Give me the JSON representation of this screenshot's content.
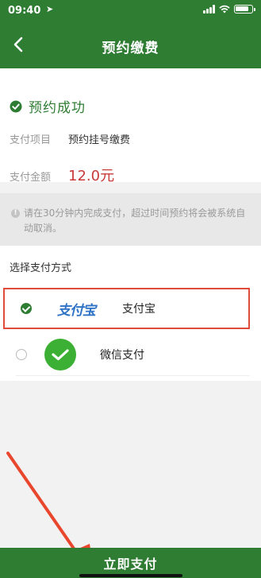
{
  "status_bar": {
    "time": "09:40"
  },
  "nav": {
    "title": "预约缴费"
  },
  "result": {
    "status": "预约成功"
  },
  "details": [
    {
      "label": "支付项目",
      "value": "预约挂号缴费"
    },
    {
      "label": "支付金额",
      "value": "12.0元"
    }
  ],
  "notice": {
    "text": "请在30分钟内完成支付，超过时间预约将会被系统自动取消。"
  },
  "payment": {
    "heading": "选择支付方式",
    "options": [
      {
        "logo_text": "支付宝",
        "label": "支付宝",
        "selected": true
      },
      {
        "label": "微信支付",
        "selected": false
      }
    ]
  },
  "footer": {
    "pay_button": "立即支付"
  },
  "colors": {
    "brand_green": "#2f7c33",
    "highlight_red": "#e04b3a",
    "amount_red": "#c83a3a"
  },
  "icons": [
    "back-arrow-icon",
    "location-arrow-icon",
    "signal-icon",
    "wifi-icon",
    "battery-icon",
    "success-check-icon",
    "info-icon",
    "alipay-logo",
    "wechat-logo-icon"
  ]
}
